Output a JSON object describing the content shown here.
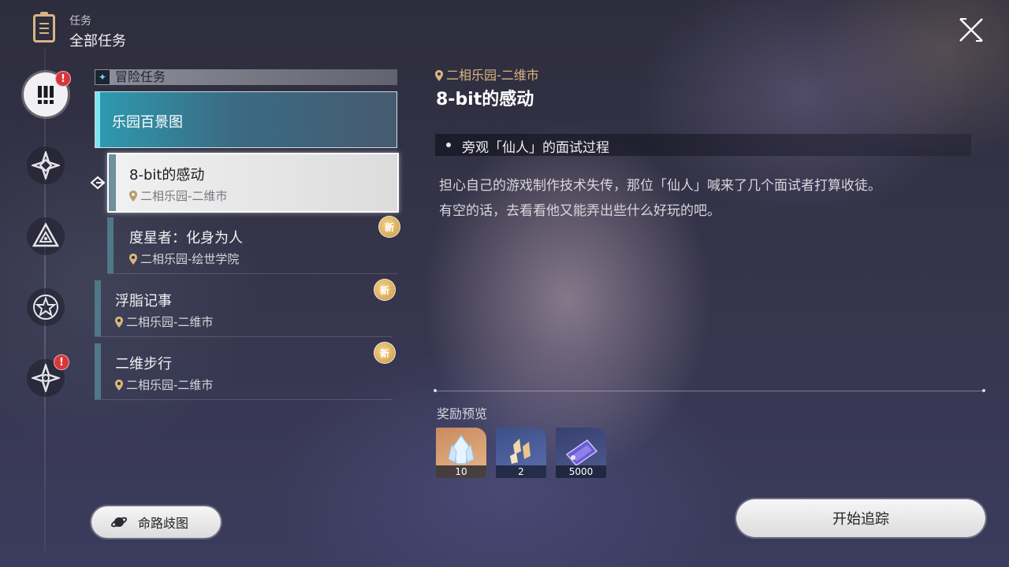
{
  "header": {
    "subtitle": "任务",
    "title": "全部任务"
  },
  "sidebar": {
    "items": [
      {
        "icon": "exclamation-icon",
        "active": true,
        "badge": "!"
      },
      {
        "icon": "compass-star-icon",
        "active": false
      },
      {
        "icon": "triangle-eye-icon",
        "active": false
      },
      {
        "icon": "star-ring-icon",
        "active": false
      },
      {
        "icon": "four-point-star-icon",
        "active": false,
        "badge": "!"
      }
    ]
  },
  "quest_list": {
    "category": "冒险任务",
    "group": "乐园百景图",
    "quests": [
      {
        "title": "8-bit的感动",
        "location": "二相乐园-二维市",
        "selected": true,
        "is_new": false
      },
      {
        "title": "度星者：化身为人",
        "location": "二相乐园-绘世学院",
        "selected": false,
        "is_new": true
      },
      {
        "title": "浮脂记事",
        "location": "二相乐园-二维市",
        "selected": false,
        "is_new": true
      },
      {
        "title": "二维步行",
        "location": "二相乐园-二维市",
        "selected": false,
        "is_new": true
      }
    ],
    "new_badge_label": "新"
  },
  "detail": {
    "location": "二相乐园-二维市",
    "title": "8-bit的感动",
    "objective": "旁观「仙人」的面试过程",
    "description_line1": "担心自己的游戏制作技术失传，那位「仙人」喊来了几个面试者打算收徒。",
    "description_line2": "有空的话，去看看他又能弄出些什么好玩的吧。",
    "rewards_label": "奖励预览",
    "rewards": [
      {
        "icon": "crystal-icon",
        "count": "10"
      },
      {
        "icon": "feather-shards-icon",
        "count": "2"
      },
      {
        "icon": "purple-ticket-icon",
        "count": "5000"
      }
    ]
  },
  "buttons": {
    "fate_map": "命路歧图",
    "start_tracking": "开始追踪"
  },
  "colors": {
    "accent_gold": "#d9b57e",
    "accent_teal": "#2d9bb0",
    "badge_red": "#d8363b"
  }
}
